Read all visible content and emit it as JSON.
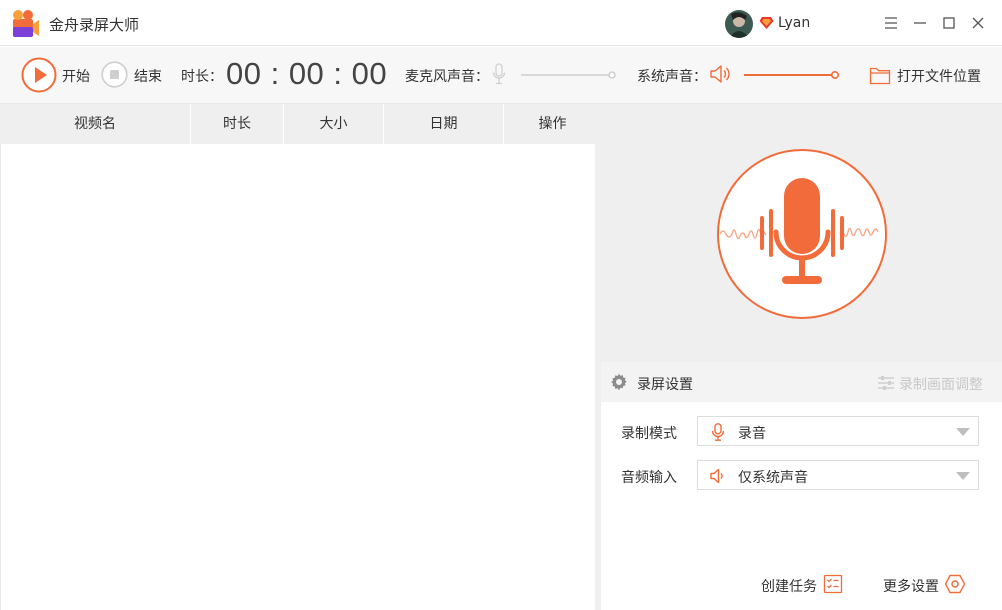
{
  "app": {
    "title": "金舟录屏大师",
    "username": "Lyan",
    "accent_color": "#f26b3a"
  },
  "window_controls": [
    "menu-icon",
    "minimize-icon",
    "maximize-icon",
    "close-icon"
  ],
  "toolbar": {
    "start_label": "开始",
    "stop_label": "结束",
    "duration_label": "时长：",
    "duration_value": "00 : 00 : 00",
    "mic_label": "麦克风声音：",
    "mic_volume": 1.0,
    "system_label": "系统声音：",
    "system_volume": 1.0,
    "open_folder_label": "打开文件位置"
  },
  "table": {
    "columns": [
      "视频名",
      "时长",
      "大小",
      "日期",
      "操作"
    ],
    "rows": []
  },
  "settings": {
    "title": "录屏设置",
    "adjust_label": "录制画面调整",
    "record_mode_label": "录制模式",
    "record_mode_value": "录音",
    "audio_input_label": "音频输入",
    "audio_input_value": "仅系统声音",
    "create_task_label": "创建任务",
    "more_settings_label": "更多设置"
  }
}
